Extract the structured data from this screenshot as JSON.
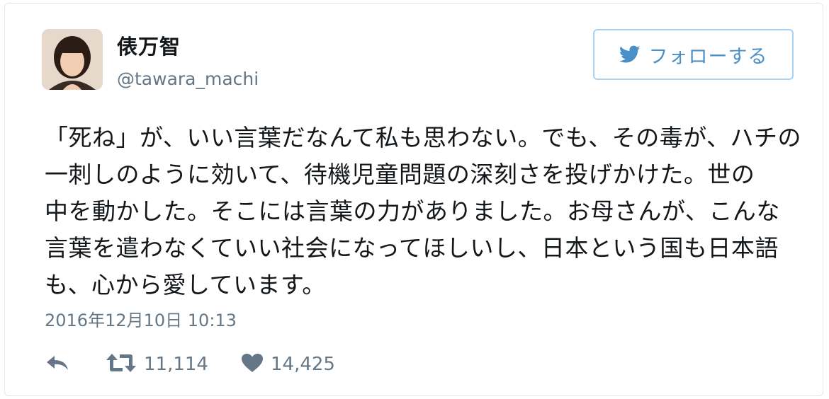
{
  "user": {
    "display_name": "俵万智",
    "screen_name": "@tawara_machi"
  },
  "follow_button": {
    "label": "フォローする",
    "icon": "twitter-bird-icon"
  },
  "tweet": {
    "lines": [
      "「死ね」が、いい言葉だなんて私も思わない。でも、その毒が、ハチの",
      "一刺しのように効いて、待機児童問題の深刻さを投げかけた。世の",
      "中を動かした。そこには言葉の力がありました。お母さんが、こんな",
      "言葉を遣わなくていい社会になってほしいし、日本という国も日本語",
      "も、心から愛しています。"
    ],
    "timestamp": "2016年12月10日 10:13"
  },
  "actions": {
    "reply_icon": "reply-icon",
    "retweet_icon": "retweet-icon",
    "retweet_count": "11,114",
    "like_icon": "heart-icon",
    "like_count": "14,425"
  },
  "colors": {
    "text": "#14171a",
    "secondary": "#657786",
    "accent": "#4a90c8",
    "button_border": "#a8d2f5"
  }
}
